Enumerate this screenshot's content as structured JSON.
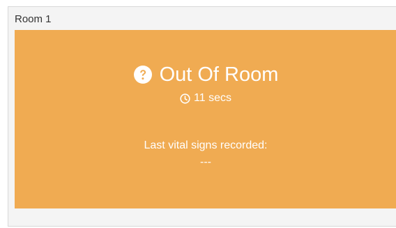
{
  "room": {
    "title": "Room 1",
    "status_label": "Out Of Room",
    "status_icon": "question-circle-icon",
    "elapsed": "11 secs",
    "elapsed_icon": "clock-icon",
    "vitals_label": "Last vital signs recorded:",
    "vitals_value": "---",
    "status_color": "#f0ab52"
  }
}
